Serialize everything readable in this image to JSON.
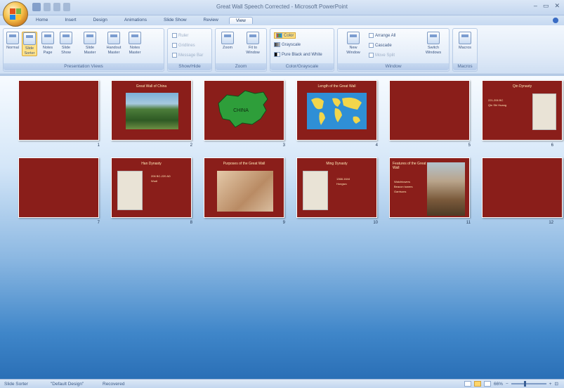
{
  "window": {
    "title": "Great Wall Speech Corrected - Microsoft PowerPoint"
  },
  "ribbon_tabs": [
    {
      "label": "Home"
    },
    {
      "label": "Insert"
    },
    {
      "label": "Design"
    },
    {
      "label": "Animations"
    },
    {
      "label": "Slide Show"
    },
    {
      "label": "Review"
    },
    {
      "label": "View",
      "active": true
    }
  ],
  "groups": {
    "presentation_views": {
      "label": "Presentation Views",
      "buttons": [
        {
          "label": "Normal"
        },
        {
          "label": "Slide Sorter",
          "selected": true
        },
        {
          "label": "Notes Page"
        },
        {
          "label": "Slide Show"
        },
        {
          "label": "Slide Master"
        },
        {
          "label": "Handout Master"
        },
        {
          "label": "Notes Master"
        }
      ]
    },
    "show_hide": {
      "label": "Show/Hide",
      "items": [
        {
          "label": "Ruler"
        },
        {
          "label": "Gridlines"
        },
        {
          "label": "Message Bar"
        }
      ]
    },
    "zoom": {
      "label": "Zoom",
      "buttons": [
        {
          "label": "Zoom"
        },
        {
          "label": "Fit to Window"
        }
      ]
    },
    "color_grayscale": {
      "label": "Color/Grayscale",
      "items": [
        {
          "label": "Color",
          "selected": true
        },
        {
          "label": "Grayscale"
        },
        {
          "label": "Pure Black and White"
        }
      ]
    },
    "window": {
      "label": "Window",
      "new_window": "New Window",
      "items": [
        {
          "label": "Arrange All"
        },
        {
          "label": "Cascade"
        },
        {
          "label": "Move Split"
        }
      ],
      "switch_windows": "Switch Windows"
    },
    "macros": {
      "label": "Macros",
      "button": "Macros"
    }
  },
  "slides": [
    {
      "num": "1",
      "title": ""
    },
    {
      "num": "2",
      "title": "Great Wall of China"
    },
    {
      "num": "3",
      "title": "",
      "caption": "CHINA"
    },
    {
      "num": "4",
      "title": "Length of the Great Wall"
    },
    {
      "num": "5",
      "title": ""
    },
    {
      "num": "6",
      "title": "Qin Dynasty",
      "bullets": [
        "221-206 BC",
        "Qin Shi Huang"
      ]
    },
    {
      "num": "7",
      "title": ""
    },
    {
      "num": "8",
      "title": "Han Dynasty",
      "bullets": [
        "206 BC-220 AD",
        "Wudi"
      ]
    },
    {
      "num": "9",
      "title": "Purposes of the Great Wall"
    },
    {
      "num": "10",
      "title": "Ming Dynasty",
      "bullets": [
        "1368-1644",
        "Hongwu"
      ]
    },
    {
      "num": "11",
      "title": "Features of the Great Wall",
      "bullets": [
        "Watchtowers",
        "Beacon towers",
        "Garrisons"
      ]
    },
    {
      "num": "12",
      "title": ""
    }
  ],
  "statusbar": {
    "view": "Slide Sorter",
    "theme": "\"Default Design\"",
    "language": "Recovered",
    "zoom": "66%"
  }
}
